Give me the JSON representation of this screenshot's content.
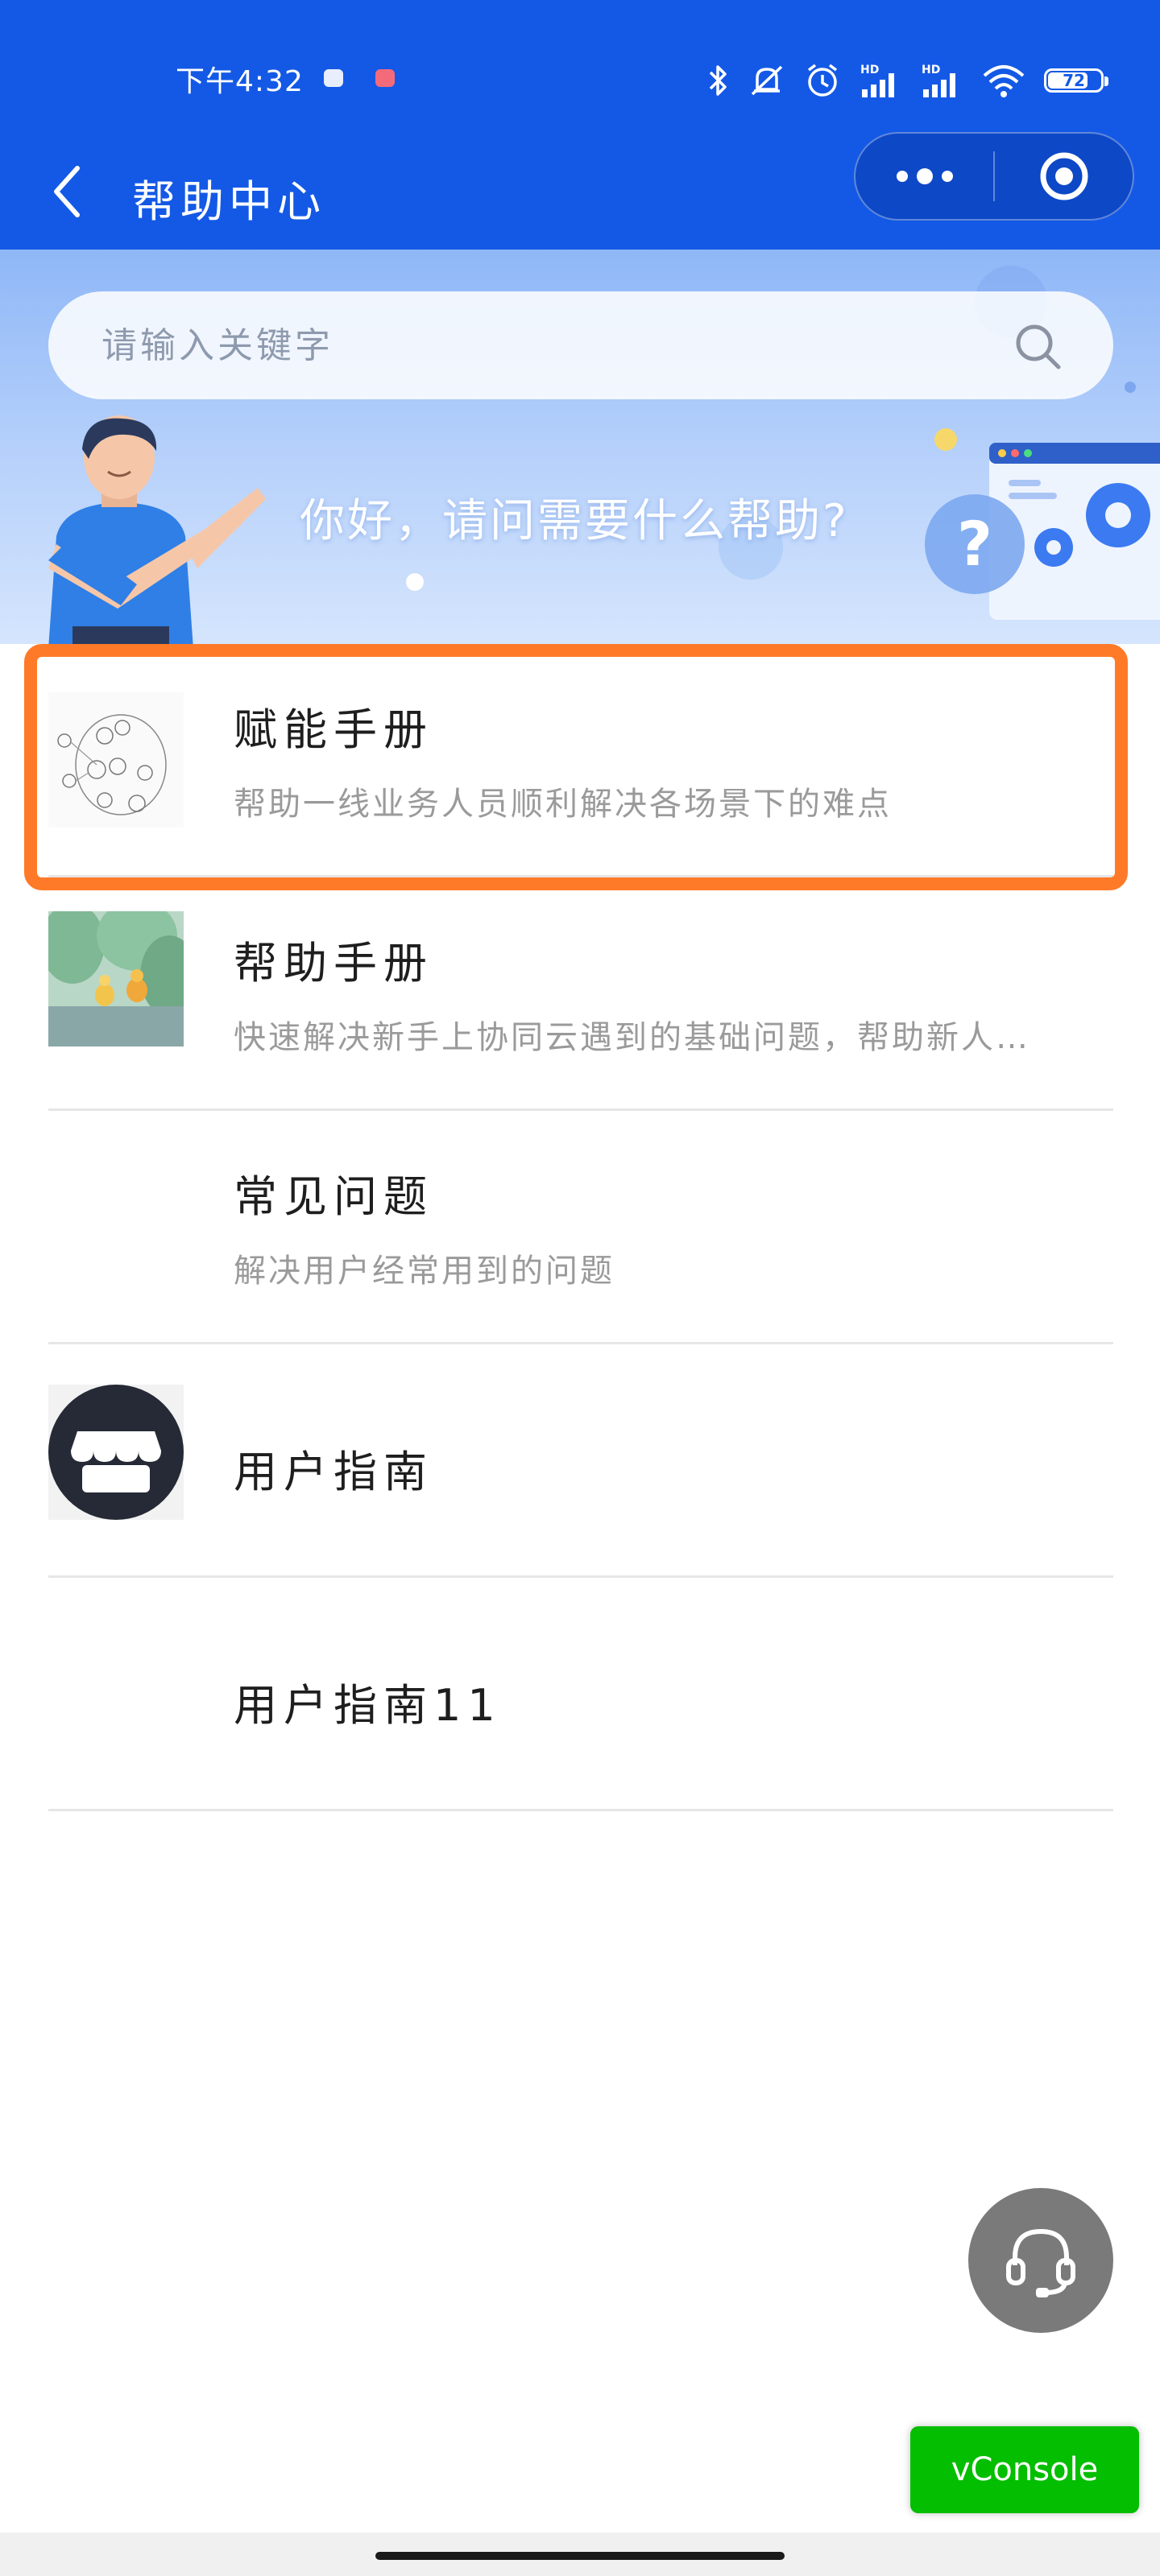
{
  "status_bar": {
    "time": "下午4:32",
    "battery_level": "72",
    "network_labels": [
      "HD",
      "HD"
    ]
  },
  "nav": {
    "title": "帮助中心"
  },
  "banner": {
    "search_placeholder": "请输入关键字",
    "greeting": "你好，请问需要什么帮助?"
  },
  "items": [
    {
      "title": "赋能手册",
      "desc": "帮助一线业务人员顺利解决各场景下的难点",
      "thumb": "mindmap-sketch"
    },
    {
      "title": "帮助手册",
      "desc": "快速解决新手上协同云遇到的基础问题，帮助新人…",
      "thumb": "rainy-scene-illustration"
    },
    {
      "title": "常见问题",
      "desc": "解决用户经常用到的问题",
      "thumb": ""
    },
    {
      "title": "用户指南",
      "desc": "",
      "thumb": "store-icon"
    },
    {
      "title": "用户指南11",
      "desc": "",
      "thumb": ""
    }
  ],
  "floating": {
    "vconsole_label": "vConsole",
    "service_icon": "headset-icon"
  },
  "colors": {
    "primary": "#1459e6",
    "highlight": "#ff7a28",
    "vconsole": "#04be02"
  }
}
